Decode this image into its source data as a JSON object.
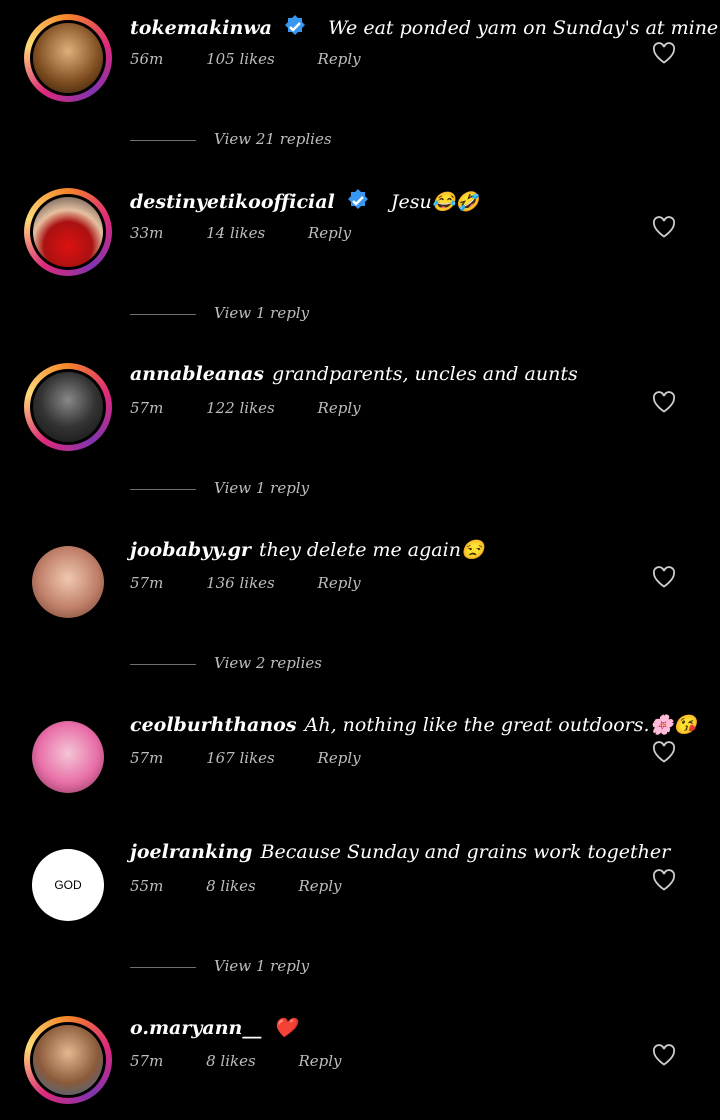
{
  "comments": [
    {
      "username": "tokemakinwa",
      "verified": true,
      "text": "We eat ponded yam on Sunday's at mine",
      "time": "56m",
      "likes": "105 likes",
      "reply": "Reply",
      "avatar_color": "#8a5a2b"
    },
    {
      "username": "destinyetikoofficial",
      "verified": true,
      "text": "Jesu😂🤣",
      "time": "33m",
      "likes": "14 likes",
      "reply": "Reply",
      "avatar_color": "#b22222"
    },
    {
      "username": "annableanas",
      "verified": false,
      "text": "grandparents, uncles and aunts",
      "time": "57m",
      "likes": "122 likes",
      "reply": "Reply",
      "avatar_color": "#3a3a3a"
    },
    {
      "username": "joobabyy.gr",
      "verified": false,
      "text": "they delete me again😒",
      "time": "57m",
      "likes": "136 likes",
      "reply": "Reply",
      "avatar_color": "#d8a38a"
    },
    {
      "username": "ceolburhthanos",
      "verified": false,
      "text": "Ah, nothing like the great outdoors.🌸😘",
      "time": "57m",
      "likes": "167 likes",
      "reply": "Reply",
      "avatar_color": "#e86fa8"
    },
    {
      "username": "joelranking",
      "verified": false,
      "text": "Because Sunday and grains work together",
      "time": "55m",
      "likes": "8 likes",
      "reply": "Reply",
      "avatar_text": "GOD"
    },
    {
      "username": "o.maryann__",
      "verified": false,
      "text": "❤️",
      "time": "57m",
      "likes": "8 likes",
      "reply": "Reply",
      "avatar_color": "#c98a5e"
    }
  ],
  "view_replies": [
    "View 21 replies",
    "View 1 reply",
    "View 1 reply",
    "View 2 replies",
    "View 1 reply"
  ]
}
